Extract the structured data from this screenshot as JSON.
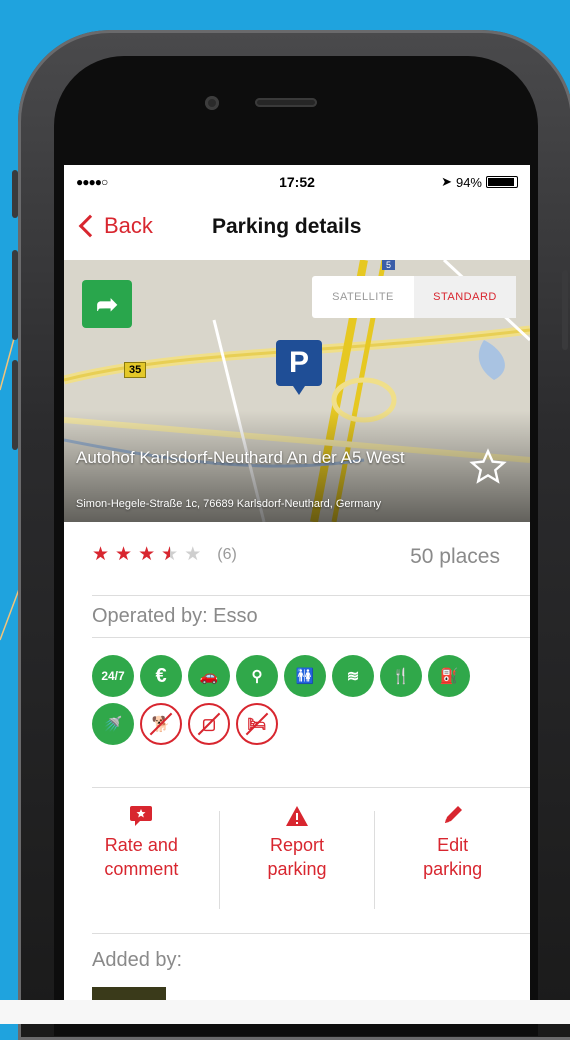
{
  "status": {
    "signal": "●●●●○",
    "time": "17:52",
    "battery": "94%"
  },
  "nav": {
    "back_label": "Back",
    "title": "Parking details"
  },
  "map": {
    "toggle_satellite": "SATELLITE",
    "toggle_standard": "STANDARD",
    "selected_view": "STANDARD",
    "pin_label": "P",
    "road_35": "35",
    "road_5": "5",
    "name": "Autohof Karlsdorf-Neuthard An der A5 West",
    "address": "Simon-Hegele-Straße 1c, 76689 Karlsdorf-Neuthard, Germany"
  },
  "rating": {
    "stars": 3.5,
    "count": "(6)"
  },
  "places": "50 places",
  "operated_by": "Operated by: Esso",
  "amenities": {
    "available": [
      "24/7",
      "€",
      "car",
      "location",
      "toilets",
      "wifi",
      "restaurant",
      "fuel",
      "shower"
    ],
    "unavailable": [
      "no-dogs",
      "no-lighting",
      "no-hotel"
    ],
    "labels": {
      "a247": "24/7",
      "euro": "€"
    }
  },
  "actions": {
    "rate": "Rate and comment",
    "report": "Report parking",
    "edit": "Edit parking"
  },
  "added_by": "Added by:",
  "colors": {
    "accent": "#d8262f",
    "green": "#30a84a",
    "pin": "#1f4e96",
    "background": "#1fa3de"
  }
}
